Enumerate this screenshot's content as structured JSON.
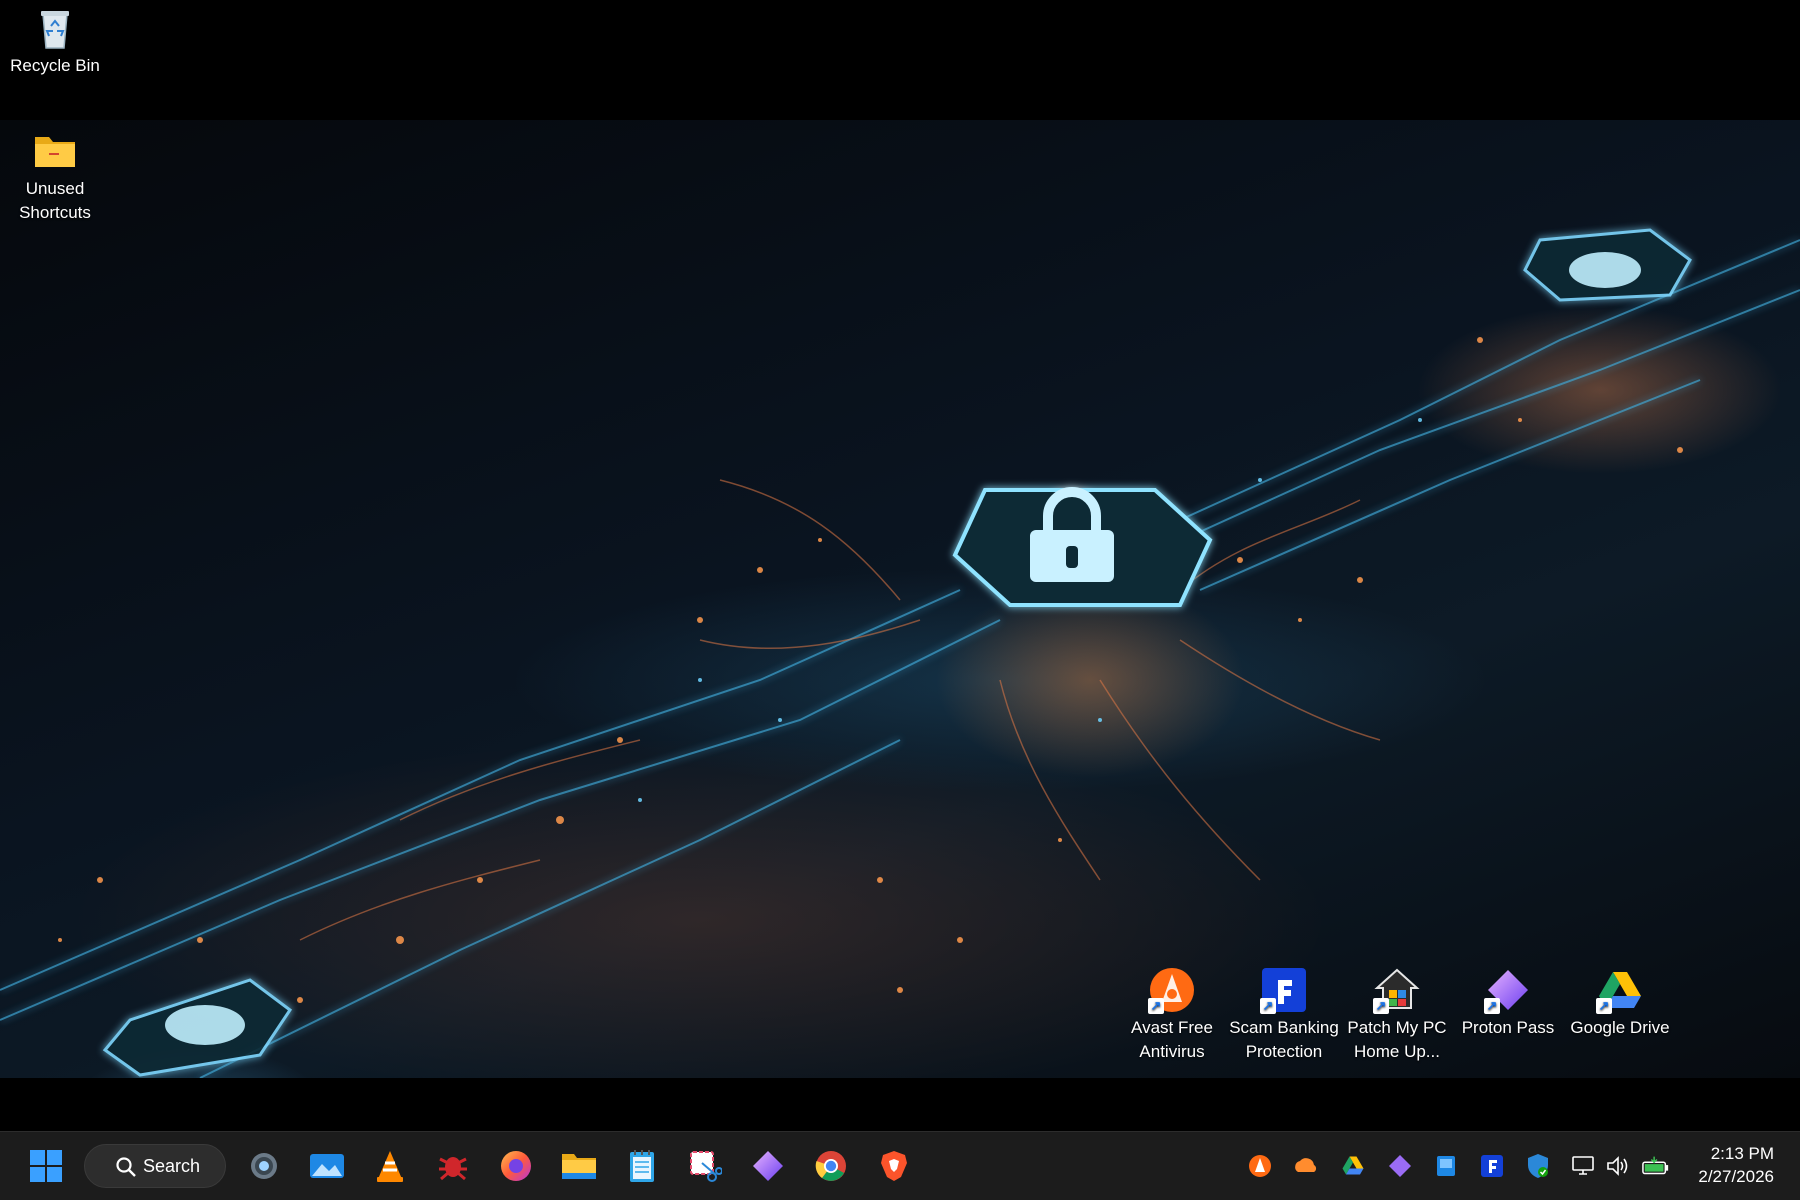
{
  "desktop_icons": {
    "recycle_bin": "Recycle Bin",
    "unused_shortcuts_1": "Unused",
    "unused_shortcuts_2": "Shortcuts",
    "avast_1": "Avast Free",
    "avast_2": "Antivirus",
    "scam_1": "Scam Banking",
    "scam_2": "Protection",
    "patch_1": "Patch My PC",
    "patch_2": "Home Up...",
    "proton": "Proton Pass",
    "gdrive": "Google Drive"
  },
  "taskbar": {
    "search_label": "Search",
    "pinned_apps": [
      "start-icon",
      "settings-icon",
      "photos-icon",
      "vlc-icon",
      "bug-app-icon",
      "firefox-icon",
      "file-explorer-icon",
      "notepad-icon",
      "snipping-tool-icon",
      "proton-pass-icon",
      "chrome-icon",
      "brave-icon"
    ],
    "tray_icons": [
      "avast-tray-icon",
      "onedrive-icon",
      "google-drive-tray-icon",
      "proton-pass-tray-icon",
      "windows-security-tray-icon",
      "scam-banking-tray-icon",
      "defender-icon",
      "network-icon",
      "volume-icon",
      "battery-icon"
    ]
  },
  "clock": {
    "time": "2:13 PM",
    "date": "2/27/2026"
  },
  "colors": {
    "taskbar_bg": "#1c1c1c",
    "accent_blue": "#0078d4",
    "wallpaper_cyan": "#5ad3ff",
    "wallpaper_orange": "#ff8a3d"
  }
}
